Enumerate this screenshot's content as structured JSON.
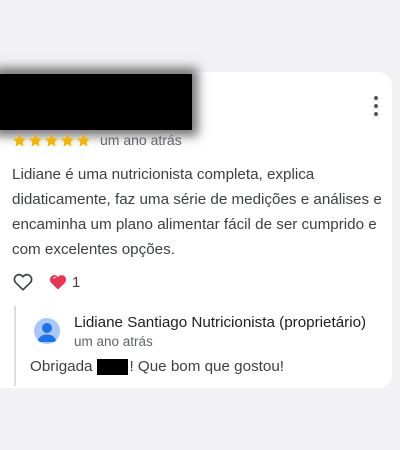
{
  "review": {
    "rating_stars": 5,
    "rating_max": 5,
    "time_ago": "um ano atrás",
    "text": "Lidiane é uma nutricionista completa, explica didaticamente, faz uma série de medições e análises e encaminha um plano alimentar fácil de ser cumprido e com excelentes opções.",
    "reaction_count": "1",
    "icons": {
      "menu": "more-vert-icon",
      "like": "heart-outline-icon",
      "reaction": "heart-filled-icon",
      "star": "star-icon"
    },
    "colors": {
      "star": "#f4b400",
      "reaction_heart": "#e8344e"
    }
  },
  "owner_reply": {
    "name": "Lidiane Santiago Nutricionista (proprietário)",
    "time_ago": "um ano atrás",
    "text_before": "Obrigada",
    "text_after": "! Que bom que gostou!",
    "icons": {
      "avatar": "user-avatar-icon"
    },
    "colors": {
      "avatar_bg": "#a8c7fa",
      "avatar_fg": "#1a73e8"
    }
  }
}
